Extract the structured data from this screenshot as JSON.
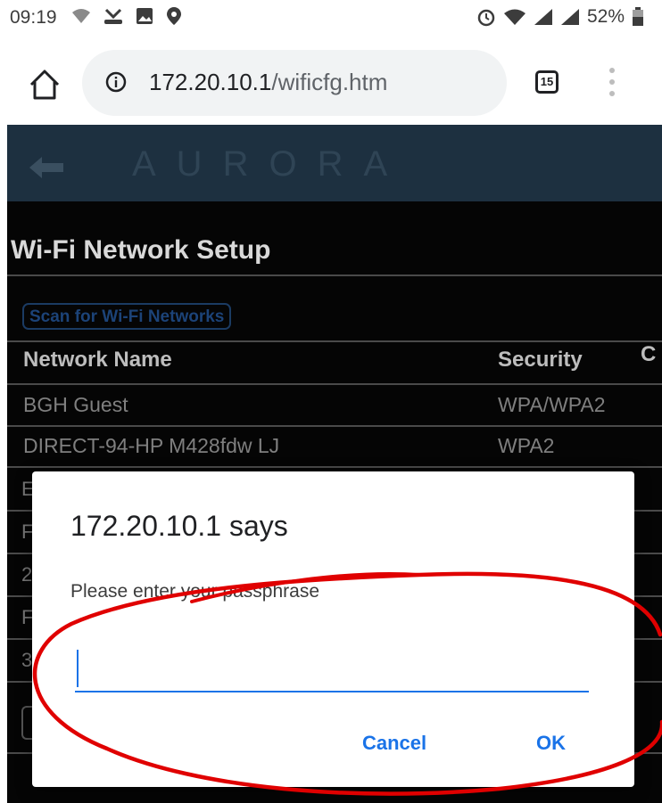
{
  "status_bar": {
    "time": "09:19",
    "battery": "52%"
  },
  "browser": {
    "url_host": "172.20.10.1",
    "url_path": "/wificfg.htm",
    "tab_count": "15"
  },
  "page": {
    "logo": "AURORA",
    "title": "Wi-Fi Network Setup",
    "scan_button": "Scan for Wi-Fi Networks",
    "table": {
      "headers": [
        "Network Name",
        "Security",
        "C"
      ],
      "rows": [
        {
          "name": "BGH Guest",
          "security": "WPA/WPA2"
        },
        {
          "name": "DIRECT-94-HP M428fdw LJ",
          "security": "WPA2"
        }
      ],
      "partial_first_chars": [
        "E",
        "F",
        "2",
        "F",
        "3"
      ]
    }
  },
  "dialog": {
    "title": "172.20.10.1 says",
    "message": "Please enter your passphrase",
    "input_value": "",
    "cancel_label": "Cancel",
    "ok_label": "OK"
  },
  "colors": {
    "accent": "#1a73e8",
    "header_bg": "#1d3040",
    "annotation": "#e00000"
  }
}
